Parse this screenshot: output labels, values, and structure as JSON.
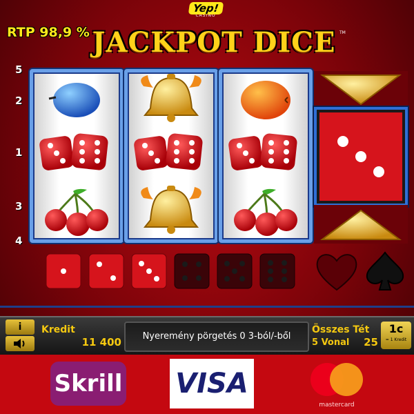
{
  "header": {
    "rtp_text": "RTP 98,9 %",
    "brand_logo": "Yep!",
    "brand_sub": "CASINO",
    "game_title": "JACKPOT DICE",
    "trademark": "TM"
  },
  "paylines": [
    "5",
    "2",
    "1",
    "3",
    "4"
  ],
  "reels": [
    {
      "symbols": [
        "plum",
        "dice-pair",
        "cherries"
      ]
    },
    {
      "symbols": [
        "bell",
        "dice-pair",
        "bell"
      ]
    },
    {
      "symbols": [
        "orange",
        "dice-pair",
        "cherries"
      ]
    }
  ],
  "gamble_die": {
    "face": 3
  },
  "dice_history": [
    {
      "face": 1,
      "active": true
    },
    {
      "face": 2,
      "active": true
    },
    {
      "face": 3,
      "active": true
    },
    {
      "face": 4,
      "active": false
    },
    {
      "face": 5,
      "active": false
    },
    {
      "face": 6,
      "active": false
    }
  ],
  "card_suits": [
    "heart-icon",
    "spade-icon"
  ],
  "control_bar": {
    "info_label": "i",
    "credit_label": "Kredit",
    "credit_value": "11 400",
    "message": "Nyeremény pörgetés 0 3-ból/-ből",
    "total_bet_label": "Összes Tét",
    "lines_label": "5 Vonal",
    "bet_value": "25",
    "coin_value": "1c",
    "coin_note": "= 1 Kredit"
  },
  "payments": {
    "skrill": "Skrill",
    "visa": "VISA",
    "mastercard": "mastercard"
  },
  "colors": {
    "background": "#9a0610",
    "gold": "#ffd21a",
    "reel_frame": "#6aa0e8",
    "die_red": "#d6141c"
  }
}
